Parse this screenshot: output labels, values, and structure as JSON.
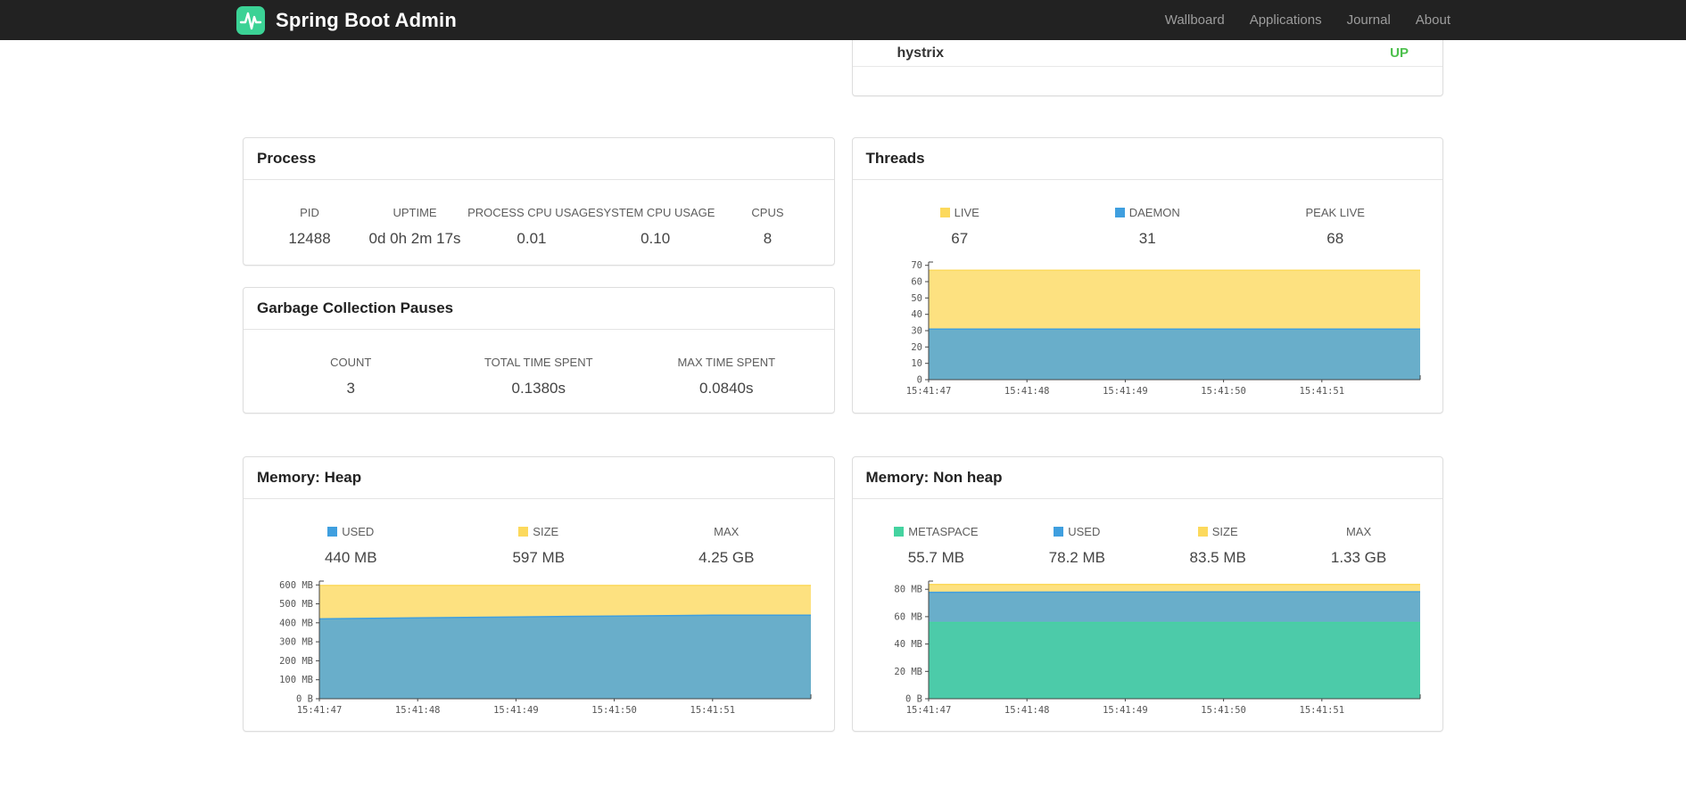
{
  "navbar": {
    "brand": "Spring Boot Admin",
    "items": [
      {
        "label": "Wallboard"
      },
      {
        "label": "Applications"
      },
      {
        "label": "Journal"
      },
      {
        "label": "About"
      }
    ]
  },
  "status_card": {
    "app_name": "hystrix",
    "status": "UP",
    "status_style": "color:#4cc04c"
  },
  "cards": {
    "process": {
      "title": "Process",
      "metrics": [
        {
          "label": "PID",
          "value": "12488"
        },
        {
          "label": "UPTIME",
          "value": "0d 0h 2m 17s"
        },
        {
          "label": "PROCESS CPU USAGE",
          "value": "0.01"
        },
        {
          "label": "SYSTEM CPU USAGE",
          "value": "0.10"
        },
        {
          "label": "CPUS",
          "value": "8"
        }
      ]
    },
    "gc": {
      "title": "Garbage Collection Pauses",
      "metrics": [
        {
          "label": "COUNT",
          "value": "3"
        },
        {
          "label": "TOTAL TIME SPENT",
          "value": "0.1380s"
        },
        {
          "label": "MAX TIME SPENT",
          "value": "0.0840s"
        }
      ]
    },
    "threads": {
      "title": "Threads",
      "metrics": [
        {
          "label": "LIVE",
          "value": "67",
          "swatch_style": "background:#fcd95c"
        },
        {
          "label": "DAEMON",
          "value": "31",
          "swatch_style": "background:#3f9fdf"
        },
        {
          "label": "PEAK LIVE",
          "value": "68"
        }
      ]
    },
    "heap": {
      "title": "Memory: Heap",
      "metrics": [
        {
          "label": "USED",
          "value": "440 MB",
          "swatch_style": "background:#3f9fdf"
        },
        {
          "label": "SIZE",
          "value": "597 MB",
          "swatch_style": "background:#fcd95c"
        },
        {
          "label": "MAX",
          "value": "4.25 GB"
        }
      ]
    },
    "nonheap": {
      "title": "Memory: Non heap",
      "metrics": [
        {
          "label": "METASPACE",
          "value": "55.7 MB",
          "swatch_style": "background:#44d3a0"
        },
        {
          "label": "USED",
          "value": "78.2 MB",
          "swatch_style": "background:#3f9fdf"
        },
        {
          "label": "SIZE",
          "value": "83.5 MB",
          "swatch_style": "background:#fcd95c"
        },
        {
          "label": "MAX",
          "value": "1.33 GB"
        }
      ]
    }
  },
  "colors": {
    "navbar_bg": "#222222",
    "brand_green": "#3bd295",
    "status_up": "#4cc04c",
    "series_yellow": "#fcd95c",
    "series_blue": "#3f9fdf",
    "series_green": "#44d3a0"
  },
  "chart_data": [
    {
      "id": "threads-chart",
      "type": "area",
      "title": "Threads",
      "x": [
        "15:41:47",
        "15:41:48",
        "15:41:49",
        "15:41:50",
        "15:41:51"
      ],
      "xlabel": "",
      "ylabel": "",
      "ylim": [
        0,
        72
      ],
      "grid": false,
      "legend_position": "top",
      "yticks": [
        {
          "value": 0,
          "label": "0"
        },
        {
          "value": 10,
          "label": "10"
        },
        {
          "value": 20,
          "label": "20"
        },
        {
          "value": 30,
          "label": "30"
        },
        {
          "value": 40,
          "label": "40"
        },
        {
          "value": 50,
          "label": "50"
        },
        {
          "value": 60,
          "label": "60"
        },
        {
          "value": 70,
          "label": "70"
        }
      ],
      "series": [
        {
          "name": "LIVE",
          "color": "#fcd95c",
          "values": [
            67,
            67,
            67,
            67,
            67
          ]
        },
        {
          "name": "DAEMON",
          "color": "#3f9fdf",
          "values": [
            31,
            31,
            31,
            31,
            31
          ]
        }
      ]
    },
    {
      "id": "heap-chart",
      "type": "area",
      "title": "Memory: Heap (MB)",
      "x": [
        "15:41:47",
        "15:41:48",
        "15:41:49",
        "15:41:50",
        "15:41:51"
      ],
      "xlabel": "",
      "ylabel": "",
      "ylim": [
        0,
        620
      ],
      "grid": false,
      "legend_position": "top",
      "yticks": [
        {
          "value": 0,
          "label": "0 B"
        },
        {
          "value": 100,
          "label": "100 MB"
        },
        {
          "value": 200,
          "label": "200 MB"
        },
        {
          "value": 300,
          "label": "300 MB"
        },
        {
          "value": 400,
          "label": "400 MB"
        },
        {
          "value": 500,
          "label": "500 MB"
        },
        {
          "value": 600,
          "label": "600 MB"
        }
      ],
      "series": [
        {
          "name": "SIZE",
          "color": "#fcd95c",
          "values": [
            597,
            597,
            597,
            597,
            597
          ]
        },
        {
          "name": "USED",
          "color": "#3f9fdf",
          "values": [
            421,
            426,
            431,
            436,
            440
          ]
        }
      ]
    },
    {
      "id": "nonheap-chart",
      "type": "area",
      "title": "Memory: Non heap (MB)",
      "x": [
        "15:41:47",
        "15:41:48",
        "15:41:49",
        "15:41:50",
        "15:41:51"
      ],
      "xlabel": "",
      "ylabel": "",
      "ylim": [
        0,
        86
      ],
      "grid": false,
      "legend_position": "top",
      "yticks": [
        {
          "value": 0,
          "label": "0 B"
        },
        {
          "value": 20,
          "label": "20 MB"
        },
        {
          "value": 40,
          "label": "40 MB"
        },
        {
          "value": 60,
          "label": "60 MB"
        },
        {
          "value": 80,
          "label": "80 MB"
        }
      ],
      "series": [
        {
          "name": "SIZE",
          "color": "#fcd95c",
          "values": [
            83.5,
            83.5,
            83.5,
            83.5,
            83.5
          ]
        },
        {
          "name": "USED",
          "color": "#3f9fdf",
          "values": [
            77.8,
            77.9,
            78.0,
            78.1,
            78.2
          ]
        },
        {
          "name": "METASPACE",
          "color": "#44d3a0",
          "values": [
            55.7,
            55.7,
            55.7,
            55.7,
            55.7
          ]
        }
      ]
    }
  ]
}
